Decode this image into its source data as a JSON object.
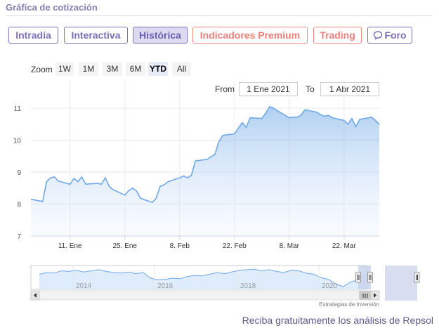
{
  "header": {
    "title": "Gráfica de cotización"
  },
  "tabs": [
    {
      "label": "Intradía",
      "active": false,
      "style": "normal"
    },
    {
      "label": "Interactiva",
      "active": false,
      "style": "normal"
    },
    {
      "label": "Histórica",
      "active": true,
      "style": "normal"
    },
    {
      "label": "Indicadores Premium",
      "active": false,
      "style": "red"
    },
    {
      "label": "Trading",
      "active": false,
      "style": "red"
    },
    {
      "label": "Foro",
      "active": false,
      "style": "normal",
      "icon": "speech-bubble-icon"
    }
  ],
  "zoom": {
    "label": "Zoom",
    "buttons": [
      "1W",
      "1M",
      "3M",
      "6M",
      "YTD",
      "All"
    ],
    "selected": "YTD"
  },
  "range": {
    "from_label": "From",
    "from_value": "1 Ene 2021",
    "to_label": "To",
    "to_value": "1 Abr 2021"
  },
  "colors": {
    "accent": "#7b6fb8",
    "premium": "#ee7f7a",
    "line": "#6fa8e6",
    "area": "#d6e7fb"
  },
  "chart_data": {
    "type": "area",
    "title": "",
    "xlabel": "",
    "ylabel": "",
    "ylim": [
      7,
      11.2
    ],
    "yticks": [
      7,
      8,
      9,
      10,
      11
    ],
    "xlim": [
      "2021-01-01",
      "2021-03-31"
    ],
    "xticks": [
      {
        "date": "2021-01-11",
        "label": "11. Ene"
      },
      {
        "date": "2021-01-25",
        "label": "25. Ene"
      },
      {
        "date": "2021-02-08",
        "label": "8. Feb"
      },
      {
        "date": "2021-02-22",
        "label": "22. Feb"
      },
      {
        "date": "2021-03-08",
        "label": "8. Mar"
      },
      {
        "date": "2021-03-22",
        "label": "22. Mar"
      }
    ],
    "grid": true,
    "series": [
      {
        "x": [
          "2021-01-01",
          "2021-01-04",
          "2021-01-05",
          "2021-01-06",
          "2021-01-07",
          "2021-01-08",
          "2021-01-11",
          "2021-01-12",
          "2021-01-13",
          "2021-01-14",
          "2021-01-15",
          "2021-01-18",
          "2021-01-19",
          "2021-01-20",
          "2021-01-21",
          "2021-01-22",
          "2021-01-25",
          "2021-01-26",
          "2021-01-27",
          "2021-01-28",
          "2021-01-29",
          "2021-02-01",
          "2021-02-02",
          "2021-02-03",
          "2021-02-04",
          "2021-02-05",
          "2021-02-08",
          "2021-02-09",
          "2021-02-10",
          "2021-02-11",
          "2021-02-12",
          "2021-02-15",
          "2021-02-16",
          "2021-02-17",
          "2021-02-18",
          "2021-02-19",
          "2021-02-22",
          "2021-02-23",
          "2021-02-24",
          "2021-02-25",
          "2021-02-26",
          "2021-03-01",
          "2021-03-02",
          "2021-03-03",
          "2021-03-04",
          "2021-03-05",
          "2021-03-08",
          "2021-03-09",
          "2021-03-10",
          "2021-03-11",
          "2021-03-12",
          "2021-03-15",
          "2021-03-16",
          "2021-03-17",
          "2021-03-18",
          "2021-03-19",
          "2021-03-22",
          "2021-03-23",
          "2021-03-24",
          "2021-03-25",
          "2021-03-26",
          "2021-03-29",
          "2021-03-30",
          "2021-03-31"
        ],
        "y": [
          8.15,
          8.08,
          8.7,
          8.82,
          8.85,
          8.72,
          8.62,
          8.8,
          8.7,
          8.85,
          8.62,
          8.65,
          8.62,
          8.82,
          8.55,
          8.45,
          8.28,
          8.42,
          8.5,
          8.4,
          8.18,
          8.05,
          8.18,
          8.55,
          8.6,
          8.7,
          8.82,
          8.88,
          8.82,
          8.9,
          9.35,
          9.4,
          9.48,
          9.55,
          9.95,
          10.15,
          10.2,
          10.38,
          10.55,
          10.4,
          10.7,
          10.68,
          10.85,
          11.05,
          11.0,
          10.92,
          10.7,
          10.72,
          10.72,
          10.78,
          10.95,
          10.88,
          10.8,
          10.75,
          10.78,
          10.7,
          10.62,
          10.5,
          10.68,
          10.42,
          10.65,
          10.72,
          10.62,
          10.5
        ]
      }
    ]
  },
  "navigator": {
    "xticks": [
      "2014",
      "2016",
      "2018",
      "2020"
    ],
    "series": [
      7.2,
      7.5,
      7.4,
      7.8,
      7.7,
      7.9,
      7.6,
      7.8,
      8.0,
      7.7,
      7.5,
      7.4,
      7.6,
      7.3,
      7.5,
      6.5,
      6.2,
      6.3,
      6.5,
      6.4,
      6.8,
      7.0,
      6.9,
      7.2,
      7.5,
      7.3,
      7.6,
      7.9,
      8.0,
      8.1,
      7.8,
      8.0,
      7.7,
      7.5,
      7.9,
      7.8,
      7.4,
      7.2,
      6.6,
      6.3,
      5.5,
      5.0,
      5.8,
      6.2,
      7.0
    ]
  },
  "credits": "Estrategias de Inversión",
  "promo": "Reciba gratuitamente los análisis de Repsol"
}
